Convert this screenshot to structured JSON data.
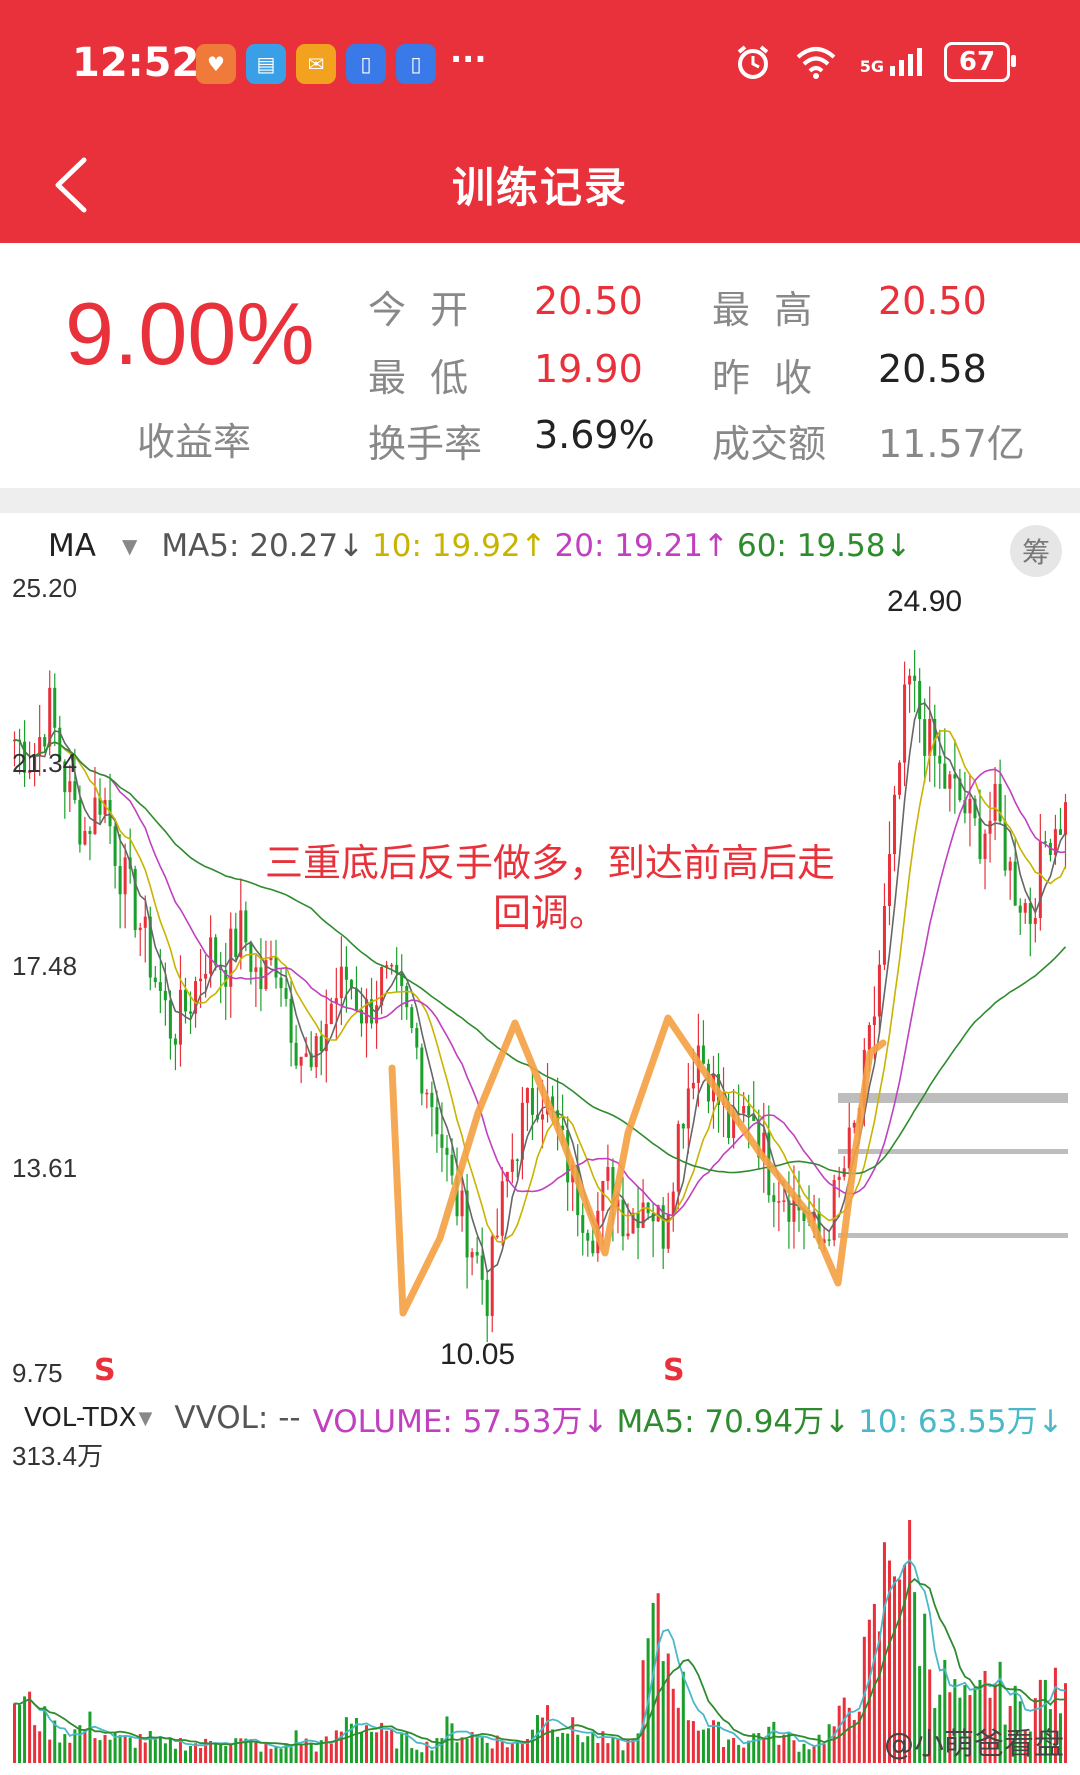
{
  "status_bar": {
    "time": "12:52",
    "app_icons": [
      "heart-app-icon",
      "book-app-icon",
      "envelope-app-icon",
      "phone-app-icon",
      "phone-app-icon-2"
    ],
    "more": "···",
    "network": "5G",
    "battery": "67"
  },
  "nav": {
    "title": "训练记录",
    "back_icon": "chevron-left-icon"
  },
  "summary": {
    "yield_value": "9.00%",
    "yield_label": "收益率",
    "open_label": "今 开",
    "open_value": "20.50",
    "high_label": "最 高",
    "high_value": "20.50",
    "low_label": "最 低",
    "low_value": "19.90",
    "prev_close_label": "昨 收",
    "prev_close_value": "20.58",
    "turnover_label": "换手率",
    "turnover_value": "3.69%",
    "amount_label": "成交额",
    "amount_value": "11.57亿"
  },
  "indicators": {
    "ma_name": "MA",
    "ma5": "MA5: 20.27↓",
    "ma10": "10: 19.92↑",
    "ma20": "20: 19.21↑",
    "ma60": "60: 19.58↓",
    "chip_label": "筹",
    "vol_name": "VOL-TDX",
    "vvol": "VVOL: --",
    "volume": "VOLUME: 57.53万↓",
    "vol_ma5": "MA5: 70.94万↓",
    "vol_ma10": "10: 63.55万↓"
  },
  "colors": {
    "brand_red": "#e8313a",
    "up_red": "#e8313a",
    "down_green": "#1aa02a",
    "ma5": "#666666",
    "ma10": "#c8b400",
    "ma20": "#c040c0",
    "ma60": "#2e8b2e",
    "annotation_orange": "#f5a041",
    "vol_ma": "#4ab8c8"
  },
  "chart_data": {
    "type": "candlestick",
    "y_axis_ticks": [
      "25.20",
      "21.34",
      "17.48",
      "13.61",
      "9.75"
    ],
    "ylim": [
      9.75,
      25.2
    ],
    "peak_label": "24.90",
    "trough_label": "10.05",
    "sell_marks": [
      "S",
      "S"
    ],
    "annotation": "三重底后反手做多，到达前高后走回调。",
    "volume_axis_max": "313.4万",
    "close_path": [
      22,
      21.6,
      22.6,
      21,
      20.2,
      21,
      19.5,
      18.6,
      17.4,
      16.3,
      16.9,
      17.9,
      17.6,
      18.3,
      17.2,
      17.8,
      16.2,
      15.4,
      16.8,
      17.4,
      16.6,
      17.3,
      16.9,
      15.9,
      14.8,
      13.2,
      12.3,
      11.2,
      13.3,
      14.6,
      15.2,
      14.3,
      13.2,
      12.5,
      13.4,
      12.6,
      13.2,
      12.4,
      14.6,
      16.1,
      15.1,
      14.2,
      15.0,
      13.6,
      13.2,
      12.8,
      12.1,
      13.2,
      14.4,
      16.4,
      19.6,
      23.2,
      22.1,
      21.2,
      20.8,
      20.1,
      20.6,
      19.2,
      18.6,
      20.2,
      20.6
    ],
    "volume_path_wan": [
      80,
      60,
      40,
      35,
      45,
      30,
      25,
      30,
      20,
      25,
      20,
      30,
      25,
      20,
      15,
      30,
      20,
      25,
      60,
      40,
      30,
      25,
      20,
      40,
      35,
      30,
      25,
      20,
      70,
      50,
      35,
      30,
      20,
      25,
      160,
      120,
      60,
      40,
      30,
      25,
      40,
      30,
      20,
      30,
      50,
      90,
      160,
      300,
      180,
      110,
      80,
      60,
      100,
      70,
      60,
      90,
      70
    ]
  },
  "watermark": "@小萌爸看盘"
}
